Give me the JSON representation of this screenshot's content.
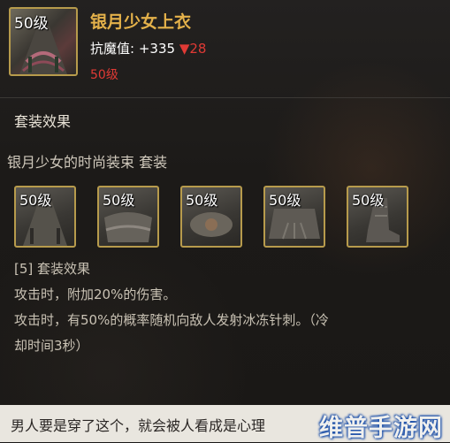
{
  "item": {
    "level_badge": "50级",
    "name": "银月少女上衣",
    "stat_label": "抗魔值:",
    "stat_value": "+335",
    "stat_delta": "▼28",
    "required_level": "50级"
  },
  "set": {
    "header": "套装效果",
    "name": "银月少女的时尚装束 套装",
    "items": [
      {
        "level": "50级"
      },
      {
        "level": "50级"
      },
      {
        "level": "50级"
      },
      {
        "level": "50级"
      },
      {
        "level": "50级"
      }
    ],
    "effects": [
      "[5] 套装效果",
      "攻击时，附加20%的伤害。",
      "攻击时，有50%的概率随机向敌人发射冰冻针刺。（冷",
      "却时间3秒）"
    ]
  },
  "caption": "男人要是穿了这个，就会被人看成是心理",
  "watermark": "维普手游网",
  "colors": {
    "gold": "#e4b14a",
    "red": "#e03a35",
    "frame": "#b79b4c"
  }
}
